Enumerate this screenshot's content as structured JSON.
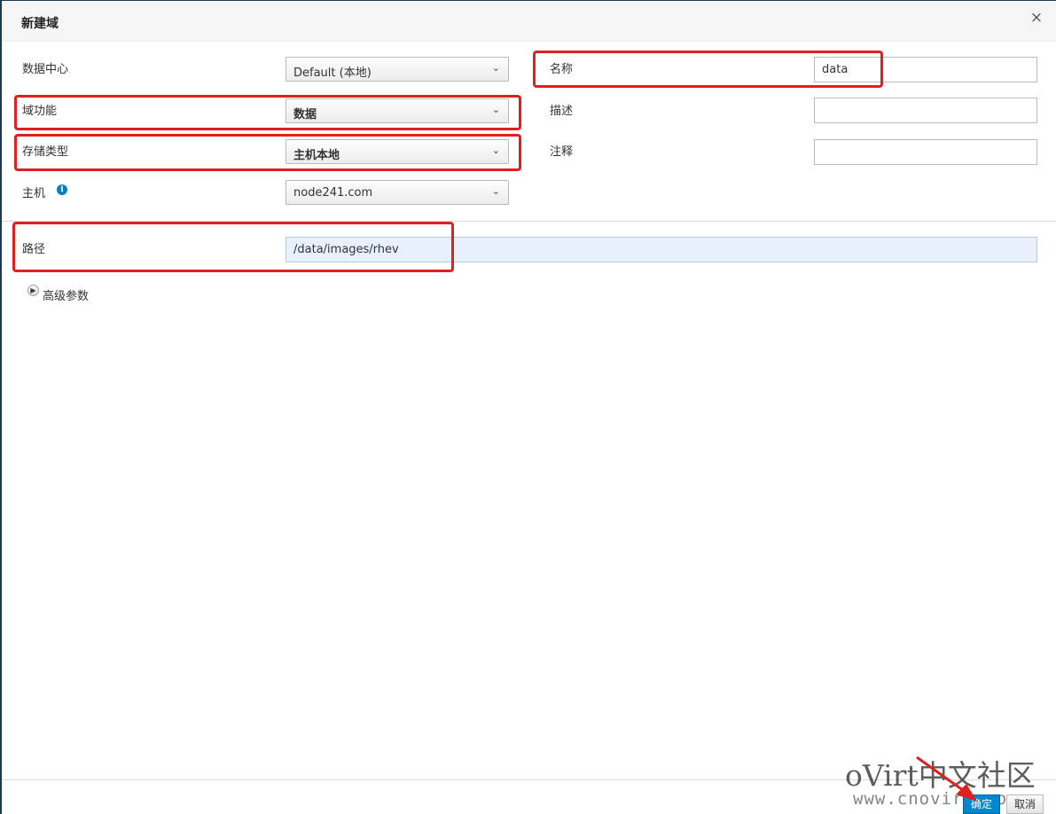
{
  "dialog": {
    "title": "新建域",
    "close_glyph": "×"
  },
  "form": {
    "data_center": {
      "label": "数据中心",
      "value": "Default (本地)"
    },
    "domain_function": {
      "label": "域功能",
      "value": "数据"
    },
    "storage_type": {
      "label": "存储类型",
      "value": "主机本地"
    },
    "host": {
      "label": "主机",
      "value": "node241.com",
      "info_icon": "info-icon"
    },
    "name": {
      "label": "名称",
      "value": "data"
    },
    "description": {
      "label": "描述",
      "value": ""
    },
    "comment": {
      "label": "注释",
      "value": ""
    },
    "path": {
      "label": "路径",
      "value": "/data/images/rhev"
    },
    "advanced": {
      "label": "高级参数"
    }
  },
  "footer": {
    "ok_label": "确定",
    "cancel_label": "取消"
  },
  "watermark": {
    "line1": "oVirt中文社区",
    "line2": "www.cnovirt.com"
  },
  "colors": {
    "highlight": "#e02020",
    "primary_button": "#0088ce",
    "path_field_bg": "#e8f0fd",
    "info_icon": "#0a7ec2"
  }
}
